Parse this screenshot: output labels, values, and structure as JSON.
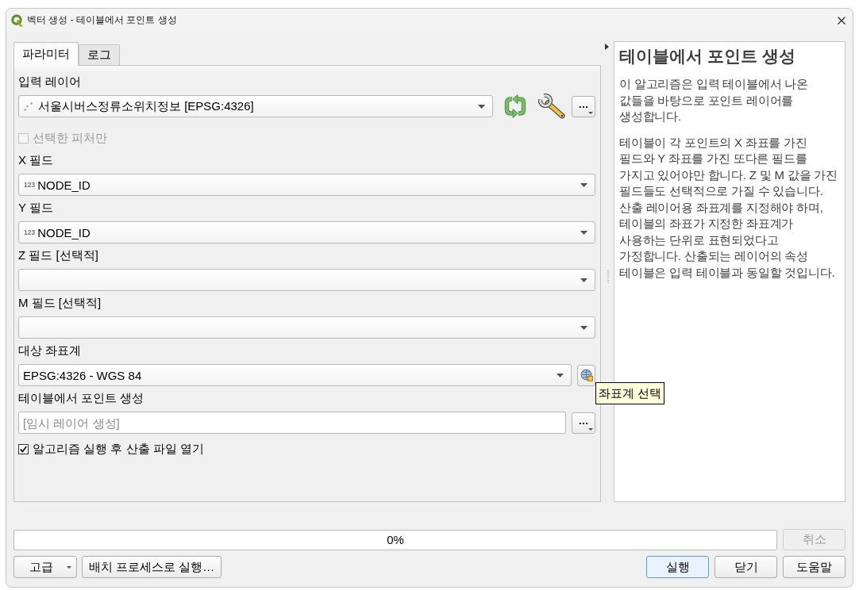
{
  "window": {
    "title": "벡터 생성 - 테이블에서 포인트 생성"
  },
  "tabs": [
    {
      "label": "파라미터",
      "selected": true
    },
    {
      "label": "로그",
      "selected": false
    }
  ],
  "parameters": [
    {
      "kind": "layer",
      "label": "입력 레이어",
      "value": "서울시버스정류소위치정보 [EPSG:4326]",
      "button": "…"
    },
    {
      "kind": "checkbox",
      "label": "선택한 피처만",
      "checked": false,
      "disabled": true
    },
    {
      "kind": "field",
      "label": "X 필드",
      "type": "123",
      "value": "NODE_ID"
    },
    {
      "kind": "field",
      "label": "Y 필드",
      "type": "123",
      "value": "NODE_ID"
    },
    {
      "kind": "field",
      "label": "Z 필드 [선택적]"
    },
    {
      "kind": "field",
      "label": "M 필드 [선택적]"
    },
    {
      "kind": "crs",
      "label": "대상 좌표계",
      "value": "EPSG:4326 - WGS 84",
      "tooltip": "좌표계 선택"
    },
    {
      "kind": "output",
      "label": "테이블에서 포인트 생성",
      "placeholder": "[임시 레이어 생성]",
      "button": "…"
    },
    {
      "kind": "checkbox",
      "label": "알고리즘 실행 후 산출 파일 열기",
      "checked": true,
      "disabled": false
    }
  ],
  "help": {
    "title": "테이블에서 포인트 생성",
    "paragraphs": [
      "이 알고리즘은 입력 테이블에서 나온 값들을 바탕으로 포인트 레이어를 생성합니다.",
      "테이블이 각 포인트의 X 좌표를 가진 필드와 Y 좌표를 가진 또다른 필드를 가지고 있어야만 합니다. Z 및 M 값을 가진 필드들도 선택적으로 가질 수 있습니다. 산출 레이어용 좌표계를 지정해야 하며, 테이블의 좌표가 지정한 좌표계가 사용하는 단위로 표현되었다고 가정합니다. 산출되는 레이어의 속성 테이블은 입력 테이블과 동일할 것입니다."
    ]
  },
  "progress": {
    "level": 0,
    "text": "0%"
  },
  "cancel_button": {
    "label": "취소",
    "disabled": true
  },
  "buttons": {
    "left": [
      {
        "label": "고급",
        "kind": "menu"
      },
      {
        "label": "배치 프로세스로 실행…",
        "kind": "plain"
      }
    ],
    "right": [
      {
        "label": "실행",
        "kind": "default"
      },
      {
        "label": "닫기",
        "kind": "plain"
      },
      {
        "label": "도움말",
        "kind": "plain"
      }
    ]
  }
}
